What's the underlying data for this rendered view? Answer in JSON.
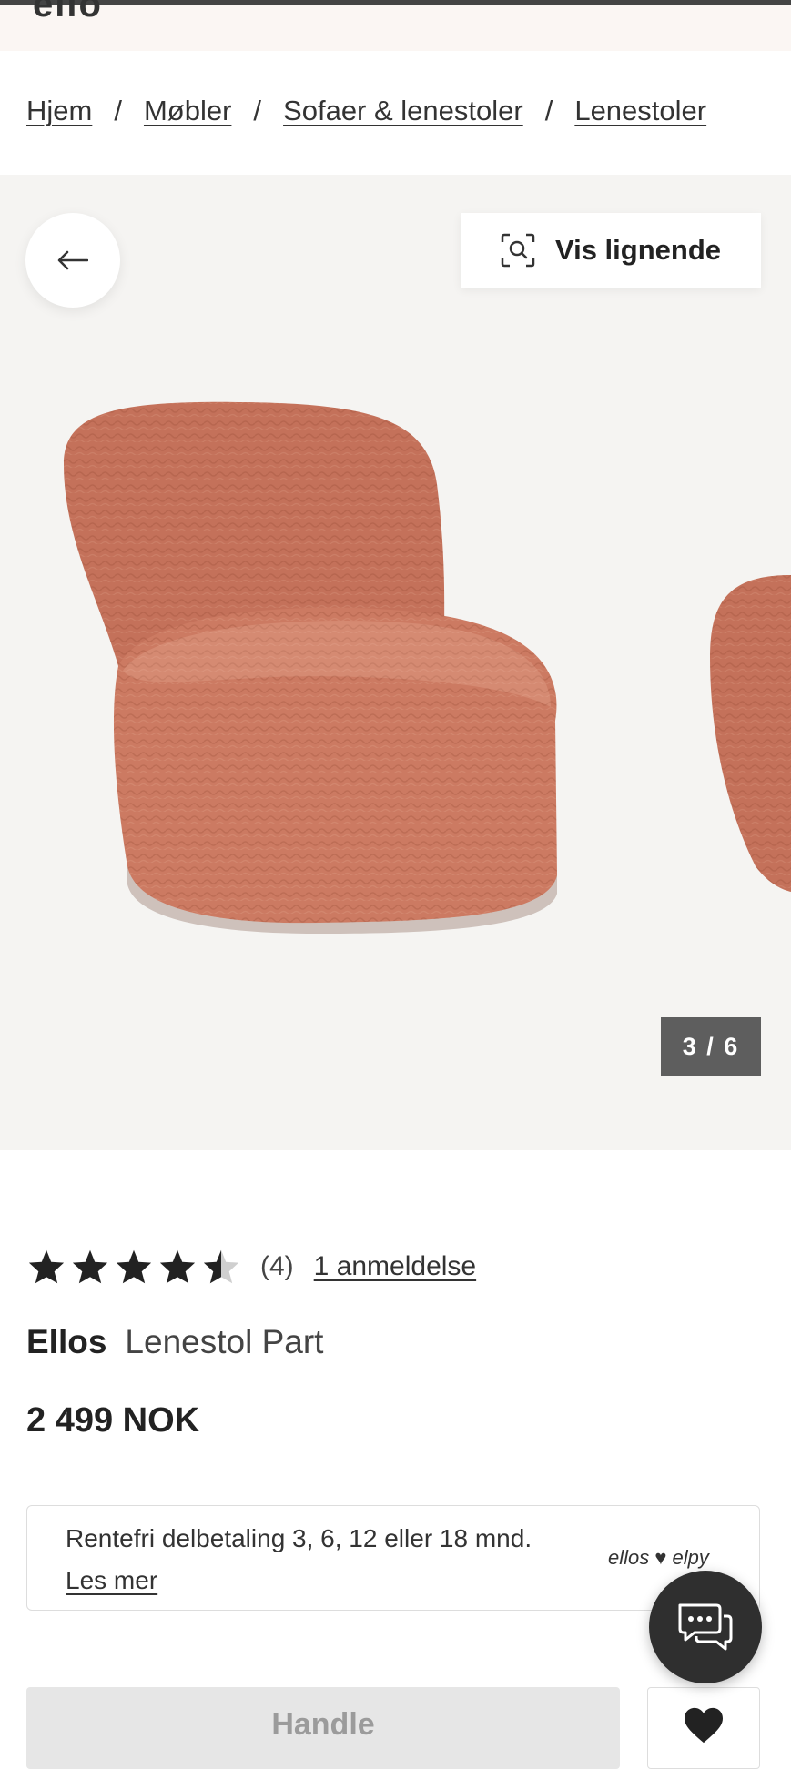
{
  "header": {
    "logo_fragment": "ello"
  },
  "breadcrumb": {
    "items": [
      "Hjem",
      "Møbler",
      "Sofaer & lenestoler",
      "Lenestoler"
    ],
    "separator": "/"
  },
  "gallery": {
    "similar_label": "Vis lignende",
    "counter": "3 / 6",
    "product_color": "#c9785f"
  },
  "product": {
    "rating": 4.5,
    "rating_max": 5,
    "rating_count": "(4)",
    "reviews_link": "1 anmeldelse",
    "brand": "Ellos",
    "name": "Lenestol Part",
    "price": "2 499 NOK"
  },
  "finance": {
    "text": "Rentefri delbetaling 3, 6, 12 eller 18 mnd.",
    "link": "Les mer",
    "partner": "ellos ♥ elpy"
  },
  "actions": {
    "buy_label": "Handle",
    "chat_icon": "chat-bubbles-icon",
    "favorite_icon": "heart-icon"
  }
}
